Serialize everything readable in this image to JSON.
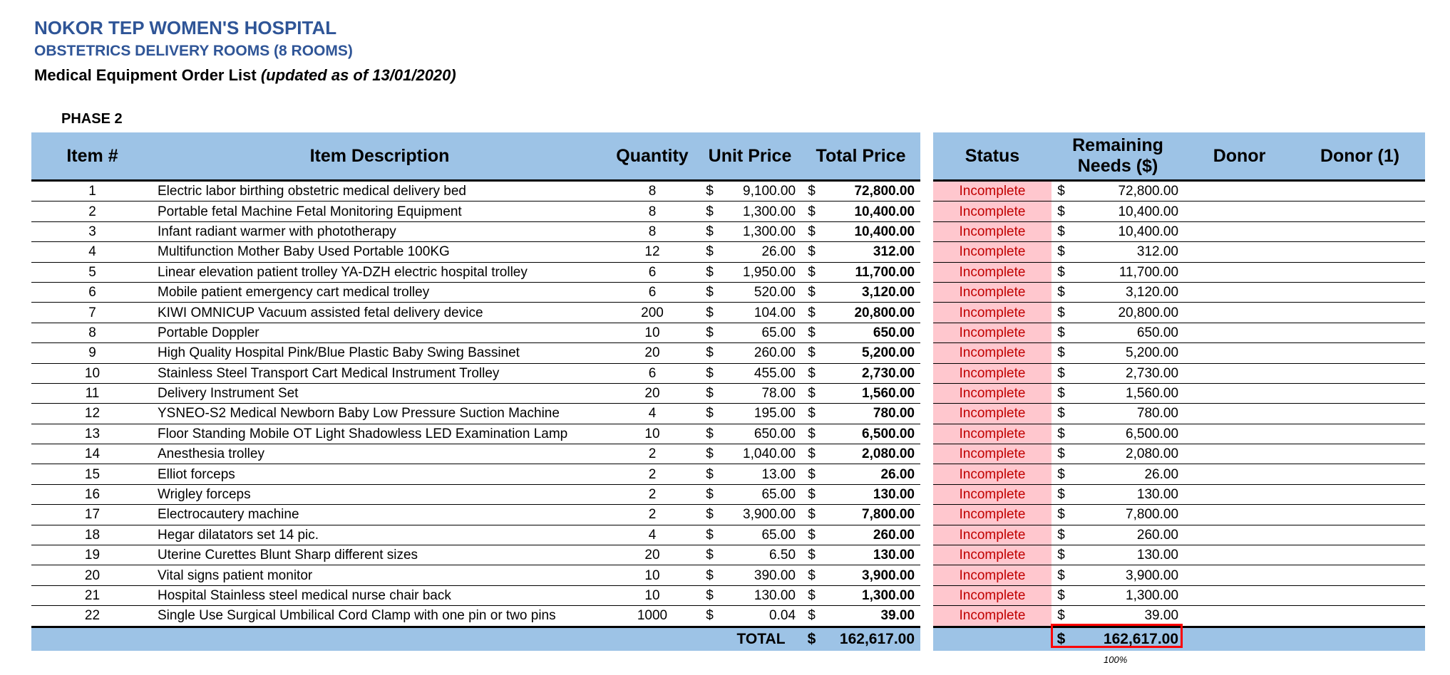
{
  "header": {
    "hospital": "NOKOR TEP WOMEN'S HOSPITAL",
    "department": "OBSTETRICS DELIVERY ROOMS (8 ROOMS)",
    "list_title": "Medical Equipment Order List",
    "updated": "(updated as of 13/01/2020)",
    "phase": "PHASE 2"
  },
  "columns": {
    "item": "Item #",
    "description": "Item Description",
    "quantity": "Quantity",
    "unit_price": "Unit Price",
    "total_price": "Total Price",
    "status": "Status",
    "remaining_line1": "Remaining",
    "remaining_line2": "Needs ($)",
    "donor": "Donor",
    "donor1": "Donor (1)"
  },
  "currency": "$",
  "rows": [
    {
      "n": "1",
      "desc": "Electric labor birthing obstetric medical delivery bed",
      "qty": "8",
      "unit": "9,100.00",
      "total": "72,800.00",
      "status": "Incomplete",
      "remaining": "72,800.00"
    },
    {
      "n": "2",
      "desc": "Portable fetal Machine Fetal Monitoring Equipment",
      "qty": "8",
      "unit": "1,300.00",
      "total": "10,400.00",
      "status": "Incomplete",
      "remaining": "10,400.00"
    },
    {
      "n": "3",
      "desc": "Infant radiant warmer with phototherapy",
      "qty": "8",
      "unit": "1,300.00",
      "total": "10,400.00",
      "status": "Incomplete",
      "remaining": "10,400.00"
    },
    {
      "n": "4",
      "desc": "Multifunction Mother Baby Used Portable 100KG",
      "qty": "12",
      "unit": "26.00",
      "total": "312.00",
      "status": "Incomplete",
      "remaining": "312.00"
    },
    {
      "n": "5",
      "desc": "Linear elevation patient trolley YA-DZH electric hospital trolley",
      "qty": "6",
      "unit": "1,950.00",
      "total": "11,700.00",
      "status": "Incomplete",
      "remaining": "11,700.00"
    },
    {
      "n": "6",
      "desc": "Mobile patient emergency cart medical trolley",
      "qty": "6",
      "unit": "520.00",
      "total": "3,120.00",
      "status": "Incomplete",
      "remaining": "3,120.00"
    },
    {
      "n": "7",
      "desc": "KIWI OMNICUP Vacuum assisted fetal delivery device",
      "qty": "200",
      "unit": "104.00",
      "total": "20,800.00",
      "status": "Incomplete",
      "remaining": "20,800.00"
    },
    {
      "n": "8",
      "desc": "Portable Doppler",
      "qty": "10",
      "unit": "65.00",
      "total": "650.00",
      "status": "Incomplete",
      "remaining": "650.00"
    },
    {
      "n": "9",
      "desc": "High Quality Hospital Pink/Blue Plastic Baby Swing Bassinet",
      "qty": "20",
      "unit": "260.00",
      "total": "5,200.00",
      "status": "Incomplete",
      "remaining": "5,200.00"
    },
    {
      "n": "10",
      "desc": "Stainless Steel Transport Cart Medical Instrument Trolley",
      "qty": "6",
      "unit": "455.00",
      "total": "2,730.00",
      "status": "Incomplete",
      "remaining": "2,730.00"
    },
    {
      "n": "11",
      "desc": "Delivery Instrument Set",
      "qty": "20",
      "unit": "78.00",
      "total": "1,560.00",
      "status": "Incomplete",
      "remaining": "1,560.00"
    },
    {
      "n": "12",
      "desc": "YSNEO-S2 Medical Newborn Baby Low Pressure Suction Machine",
      "qty": "4",
      "unit": "195.00",
      "total": "780.00",
      "status": "Incomplete",
      "remaining": "780.00"
    },
    {
      "n": "13",
      "desc": "Floor Standing Mobile OT Light Shadowless LED Examination Lamp",
      "qty": "10",
      "unit": "650.00",
      "total": "6,500.00",
      "status": "Incomplete",
      "remaining": "6,500.00"
    },
    {
      "n": "14",
      "desc": "Anesthesia trolley",
      "qty": "2",
      "unit": "1,040.00",
      "total": "2,080.00",
      "status": "Incomplete",
      "remaining": "2,080.00"
    },
    {
      "n": "15",
      "desc": "Elliot forceps",
      "qty": "2",
      "unit": "13.00",
      "total": "26.00",
      "status": "Incomplete",
      "remaining": "26.00"
    },
    {
      "n": "16",
      "desc": "Wrigley forceps",
      "qty": "2",
      "unit": "65.00",
      "total": "130.00",
      "status": "Incomplete",
      "remaining": "130.00"
    },
    {
      "n": "17",
      "desc": "Electrocautery machine",
      "qty": "2",
      "unit": "3,900.00",
      "total": "7,800.00",
      "status": "Incomplete",
      "remaining": "7,800.00"
    },
    {
      "n": "18",
      "desc": "Hegar dilatators set 14 pic.",
      "qty": "4",
      "unit": "65.00",
      "total": "260.00",
      "status": "Incomplete",
      "remaining": "260.00"
    },
    {
      "n": "19",
      "desc": "Uterine Curettes Blunt Sharp different sizes",
      "qty": "20",
      "unit": "6.50",
      "total": "130.00",
      "status": "Incomplete",
      "remaining": "130.00"
    },
    {
      "n": "20",
      "desc": "Vital signs patient monitor",
      "qty": "10",
      "unit": "390.00",
      "total": "3,900.00",
      "status": "Incomplete",
      "remaining": "3,900.00"
    },
    {
      "n": "21",
      "desc": "Hospital Stainless steel medical nurse chair back",
      "qty": "10",
      "unit": "130.00",
      "total": "1,300.00",
      "status": "Incomplete",
      "remaining": "1,300.00"
    },
    {
      "n": "22",
      "desc": "Single Use Surgical Umbilical Cord Clamp with one pin or two pins",
      "qty": "1000",
      "unit": "0.04",
      "total": "39.00",
      "status": "Incomplete",
      "remaining": "39.00"
    }
  ],
  "footer": {
    "total_label": "TOTAL",
    "total": "162,617.00",
    "remaining_total": "162,617.00",
    "percent": "100%"
  },
  "colors": {
    "header_fill": "#9dc3e6",
    "title_blue": "#2f5597",
    "status_fill": "#ffc7ce",
    "status_text": "#c00000",
    "highlight_border": "#ff0000"
  }
}
